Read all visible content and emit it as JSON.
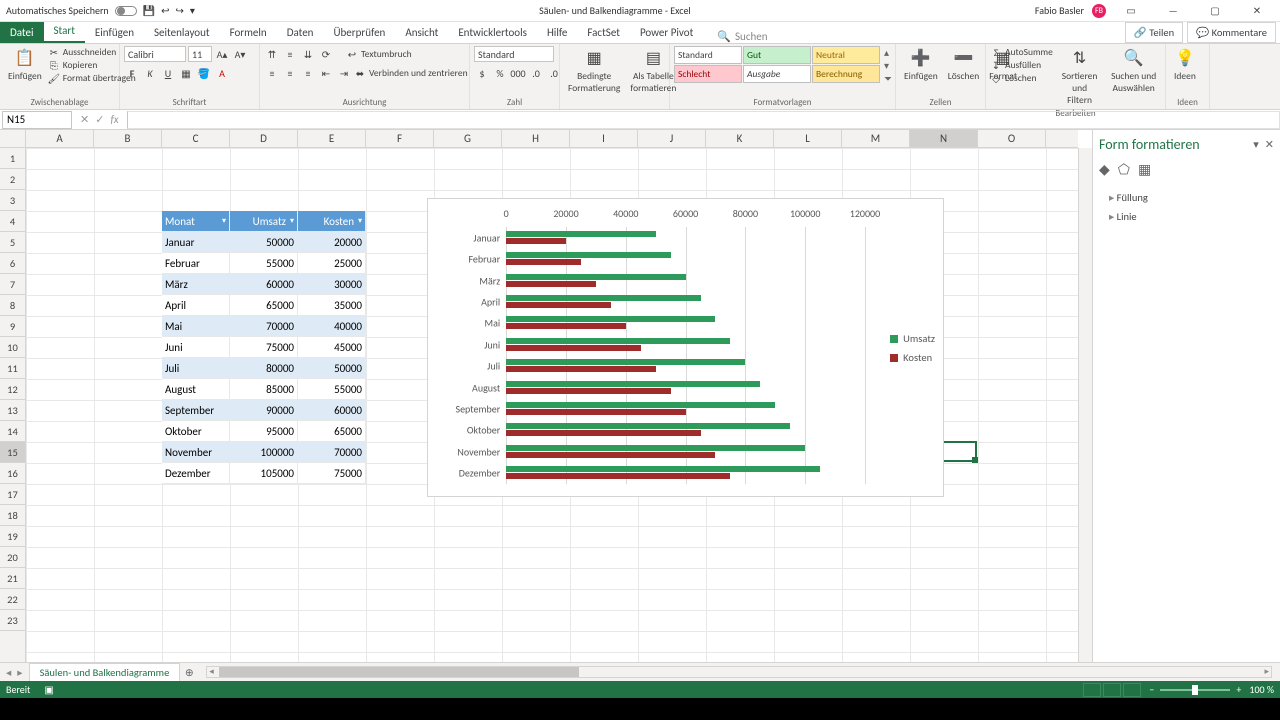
{
  "title_bar": {
    "autosave_label": "Automatisches Speichern",
    "document_title": "Säulen- und Balkendiagramme - Excel",
    "user_name": "Fabio Basler",
    "user_initials": "FB"
  },
  "ribbon": {
    "tabs": [
      "Datei",
      "Start",
      "Einfügen",
      "Seitenlayout",
      "Formeln",
      "Daten",
      "Überprüfen",
      "Ansicht",
      "Entwicklertools",
      "Hilfe",
      "FactSet",
      "Power Pivot"
    ],
    "search_placeholder": "Suchen",
    "share": "Teilen",
    "comments": "Kommentare",
    "groups": {
      "clipboard": {
        "paste": "Einfügen",
        "cut": "Ausschneiden",
        "copy": "Kopieren",
        "format_painter": "Format übertragen",
        "label": "Zwischenablage"
      },
      "font": {
        "name": "Calibri",
        "size": "11",
        "label": "Schriftart"
      },
      "alignment": {
        "wrap": "Textumbruch",
        "merge": "Verbinden und zentrieren",
        "label": "Ausrichtung"
      },
      "number": {
        "format": "Standard",
        "label": "Zahl"
      },
      "cond": {
        "cond_format": "Bedingte Formatierung",
        "as_table": "Als Tabelle formatieren"
      },
      "styles": {
        "standard": "Standard",
        "gut": "Gut",
        "neutral": "Neutral",
        "schlecht": "Schlecht",
        "ausgabe": "Ausgabe",
        "berechnung": "Berechnung",
        "label": "Formatvorlagen"
      },
      "cells": {
        "insert": "Einfügen",
        "delete": "Löschen",
        "format": "Format",
        "label": "Zellen"
      },
      "editing": {
        "autosum": "AutoSumme",
        "fill": "Ausfüllen",
        "clear": "Löschen",
        "sort": "Sortieren und Filtern",
        "find": "Suchen und Auswählen",
        "label": "Bearbeiten"
      },
      "ideas": {
        "ideas": "Ideen",
        "label": "Ideen"
      }
    }
  },
  "formula_bar": {
    "name_box": "N15"
  },
  "columns": [
    "A",
    "B",
    "C",
    "D",
    "E",
    "F",
    "G",
    "H",
    "I",
    "J",
    "K",
    "L",
    "M",
    "N",
    "O"
  ],
  "table": {
    "headers": {
      "monat": "Monat",
      "umsatz": "Umsatz",
      "kosten": "Kosten"
    },
    "rows": [
      {
        "monat": "Januar",
        "umsatz": "50000",
        "kosten": "20000"
      },
      {
        "monat": "Februar",
        "umsatz": "55000",
        "kosten": "25000"
      },
      {
        "monat": "März",
        "umsatz": "60000",
        "kosten": "30000"
      },
      {
        "monat": "April",
        "umsatz": "65000",
        "kosten": "35000"
      },
      {
        "monat": "Mai",
        "umsatz": "70000",
        "kosten": "40000"
      },
      {
        "monat": "Juni",
        "umsatz": "75000",
        "kosten": "45000"
      },
      {
        "monat": "Juli",
        "umsatz": "80000",
        "kosten": "50000"
      },
      {
        "monat": "August",
        "umsatz": "85000",
        "kosten": "55000"
      },
      {
        "monat": "September",
        "umsatz": "90000",
        "kosten": "60000"
      },
      {
        "monat": "Oktober",
        "umsatz": "95000",
        "kosten": "65000"
      },
      {
        "monat": "November",
        "umsatz": "100000",
        "kosten": "70000"
      },
      {
        "monat": "Dezember",
        "umsatz": "105000",
        "kosten": "75000"
      }
    ]
  },
  "chart_data": {
    "type": "bar",
    "categories": [
      "Januar",
      "Februar",
      "März",
      "April",
      "Mai",
      "Juni",
      "Juli",
      "August",
      "September",
      "Oktober",
      "November",
      "Dezember"
    ],
    "series": [
      {
        "name": "Umsatz",
        "color": "#2e9b5b",
        "values": [
          50000,
          55000,
          60000,
          65000,
          70000,
          75000,
          80000,
          85000,
          90000,
          95000,
          100000,
          105000
        ]
      },
      {
        "name": "Kosten",
        "color": "#a02b2b",
        "values": [
          20000,
          25000,
          30000,
          35000,
          40000,
          45000,
          50000,
          55000,
          60000,
          65000,
          70000,
          75000
        ]
      }
    ],
    "x_ticks": [
      0,
      20000,
      40000,
      60000,
      80000,
      100000,
      120000
    ],
    "xlim": [
      0,
      120000
    ],
    "legend_position": "right",
    "orientation": "horizontal"
  },
  "format_pane": {
    "title": "Form formatieren",
    "fill": "Füllung",
    "line": "Linie"
  },
  "sheet": {
    "tab_name": "Säulen- und Balkendiagramme"
  },
  "status": {
    "ready": "Bereit",
    "zoom": "100 %"
  },
  "colors": {
    "brand": "#217346",
    "table_header": "#5b9bd5"
  }
}
